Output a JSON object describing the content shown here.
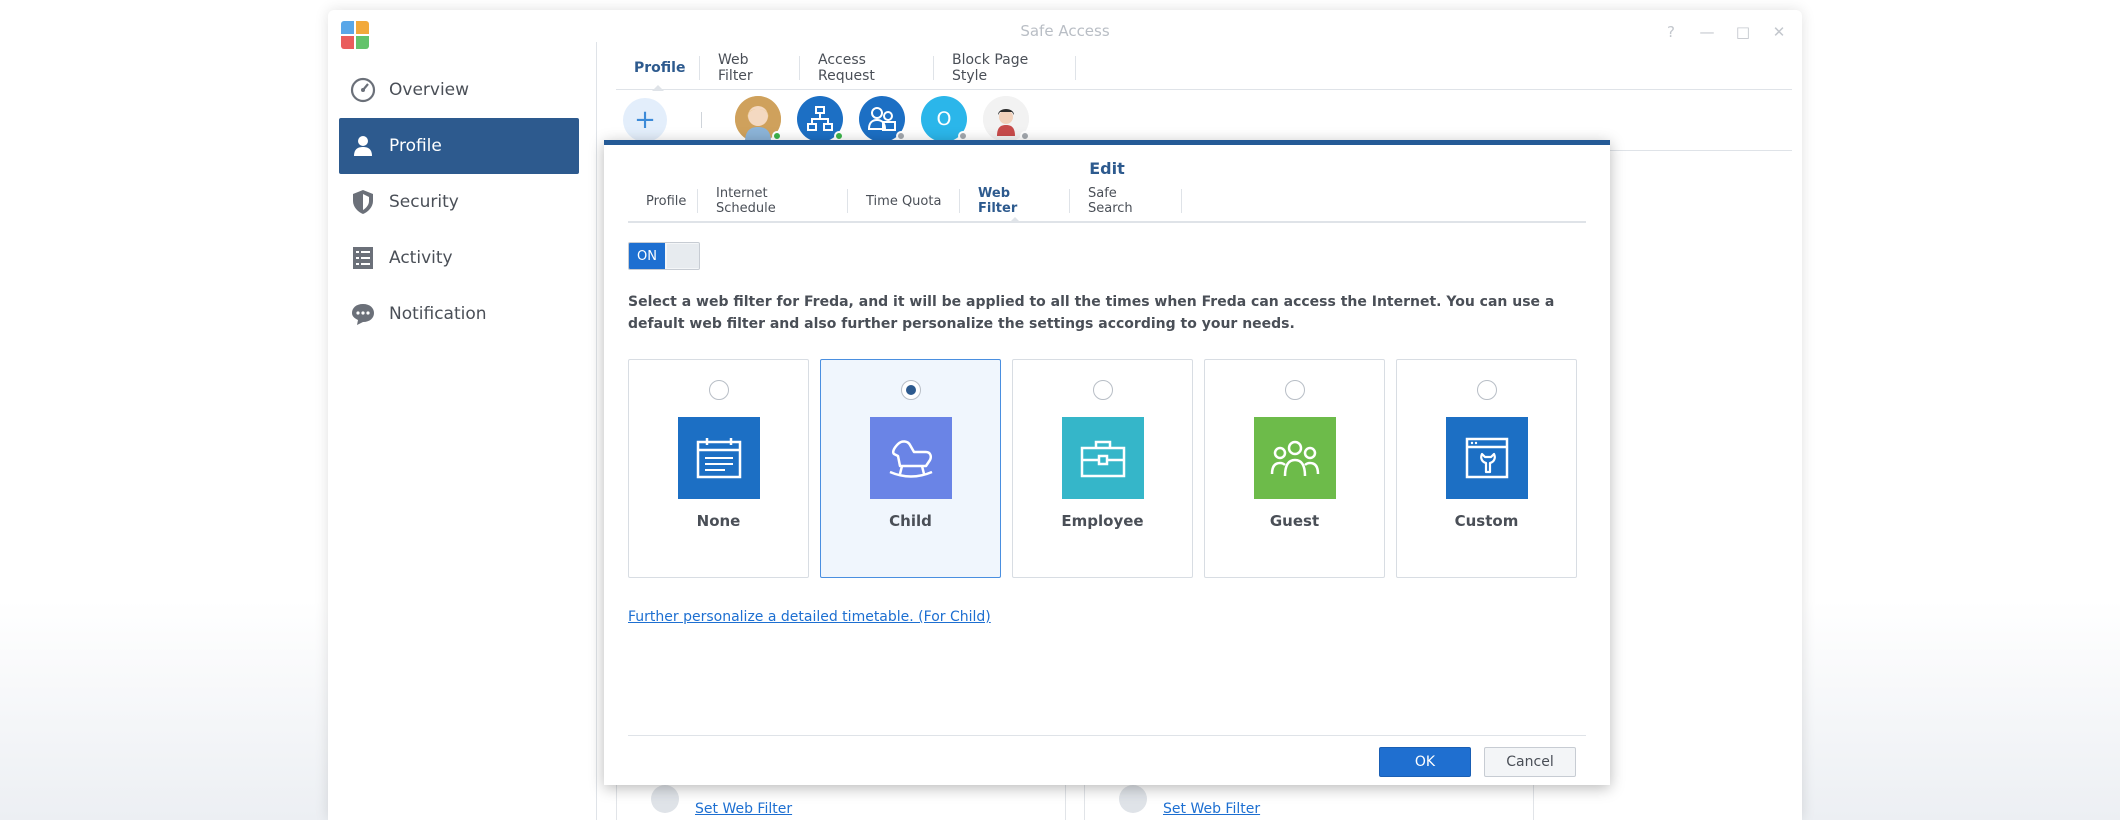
{
  "window": {
    "title": "Safe Access",
    "controls": [
      "?",
      "—",
      "□",
      "✕"
    ]
  },
  "sidebar": {
    "items": [
      {
        "label": "Overview",
        "icon": "gauge-icon"
      },
      {
        "label": "Profile",
        "icon": "person-icon",
        "active": true
      },
      {
        "label": "Security",
        "icon": "shield-icon"
      },
      {
        "label": "Activity",
        "icon": "list-icon"
      },
      {
        "label": "Notification",
        "icon": "chat-bubble-icon"
      }
    ]
  },
  "main_tabs": [
    {
      "label": "Profile",
      "active": true
    },
    {
      "label": "Web Filter"
    },
    {
      "label": "Access Request"
    },
    {
      "label": "Block Page Style"
    }
  ],
  "profiles": {
    "add_label": "+",
    "avatars": [
      {
        "kind": "photo",
        "status_color": "#3cb44b"
      },
      {
        "kind": "network",
        "status_color": "#3cb44b"
      },
      {
        "kind": "group",
        "status_color": "#a3a8ae"
      },
      {
        "kind": "initial",
        "initial": "O",
        "status_color": "#a3a8ae"
      },
      {
        "kind": "photo-small",
        "status_color": "#a3a8ae"
      }
    ]
  },
  "background_cards": [
    {
      "link": "Set Web Filter"
    },
    {
      "link": "Set Web Filter"
    }
  ],
  "dialog": {
    "title": "Edit",
    "tabs": [
      {
        "label": "Profile"
      },
      {
        "label": "Internet Schedule"
      },
      {
        "label": "Time Quota"
      },
      {
        "label": "Web Filter",
        "active": true
      },
      {
        "label": "Safe Search"
      }
    ],
    "toggle_label": "ON",
    "description": "Select a web filter for Freda, and it will be applied to all the times when Freda can access the Internet. You can use a default web filter and also further personalize the settings according to your needs.",
    "filters": [
      {
        "label": "None",
        "icon": "calendar-icon",
        "color": "#1c6fc4",
        "selected": false
      },
      {
        "label": "Child",
        "icon": "rocking-horse-icon",
        "color": "#6a84e6",
        "selected": true
      },
      {
        "label": "Employee",
        "icon": "briefcase-icon",
        "color": "#35b6c9",
        "selected": false
      },
      {
        "label": "Guest",
        "icon": "people-icon",
        "color": "#6dbb4a",
        "selected": false
      },
      {
        "label": "Custom",
        "icon": "window-wrench-icon",
        "color": "#1c6fc4",
        "selected": false
      }
    ],
    "further_link": "Further personalize a detailed timetable. (For Child)",
    "ok_label": "OK",
    "cancel_label": "Cancel"
  }
}
